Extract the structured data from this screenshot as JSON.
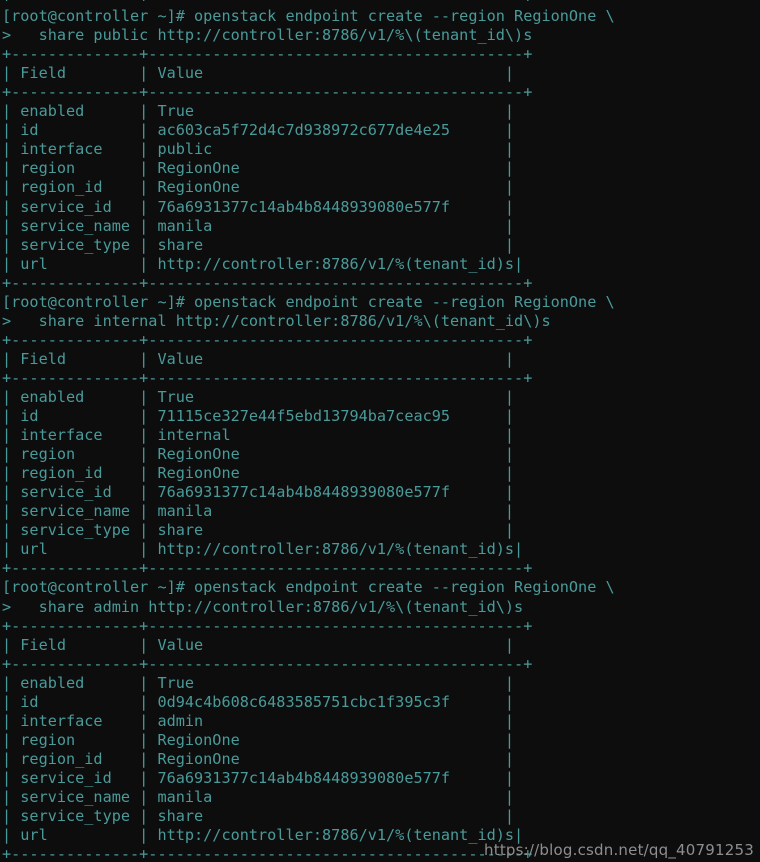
{
  "terminal": {
    "title": "root@controller:~",
    "background_color": "#0d0d0d",
    "foreground_color": "#4a9a9a",
    "prompt": "[root@controller ~]# ",
    "continuation_prompt": "> ",
    "cols": 66,
    "rows": 46
  },
  "table": {
    "headers": [
      "Field",
      "Value"
    ],
    "field_col_width": 14,
    "value_col_width": 39,
    "separator_line": "+--------------+-----------------------------------------+"
  },
  "blocks": [
    {
      "command_line_1": "[root@controller ~]# openstack endpoint create --region RegionOne \\",
      "command_line_2": ">   share public http://controller:8786/v1/%\\(tenant_id\\)s",
      "rows": [
        {
          "field": "enabled",
          "value": "True"
        },
        {
          "field": "id",
          "value": "ac603ca5f72d4c7d938972c677de4e25"
        },
        {
          "field": "interface",
          "value": "public"
        },
        {
          "field": "region",
          "value": "RegionOne"
        },
        {
          "field": "region_id",
          "value": "RegionOne"
        },
        {
          "field": "service_id",
          "value": "76a6931377c14ab4b8448939080e577f"
        },
        {
          "field": "service_name",
          "value": "manila"
        },
        {
          "field": "service_type",
          "value": "share"
        },
        {
          "field": "url",
          "value": "http://controller:8786/v1/%(tenant_id)s"
        }
      ]
    },
    {
      "command_line_1": "[root@controller ~]# openstack endpoint create --region RegionOne \\",
      "command_line_2": ">   share internal http://controller:8786/v1/%\\(tenant_id\\)s",
      "rows": [
        {
          "field": "enabled",
          "value": "True"
        },
        {
          "field": "id",
          "value": "71115ce327e44f5ebd13794ba7ceac95"
        },
        {
          "field": "interface",
          "value": "internal"
        },
        {
          "field": "region",
          "value": "RegionOne"
        },
        {
          "field": "region_id",
          "value": "RegionOne"
        },
        {
          "field": "service_id",
          "value": "76a6931377c14ab4b8448939080e577f"
        },
        {
          "field": "service_name",
          "value": "manila"
        },
        {
          "field": "service_type",
          "value": "share"
        },
        {
          "field": "url",
          "value": "http://controller:8786/v1/%(tenant_id)s"
        }
      ]
    },
    {
      "command_line_1": "[root@controller ~]# openstack endpoint create --region RegionOne \\",
      "command_line_2": ">   share admin http://controller:8786/v1/%\\(tenant_id\\)s",
      "rows": [
        {
          "field": "enabled",
          "value": "True"
        },
        {
          "field": "id",
          "value": "0d94c4b608c6483585751cbc1f395c3f"
        },
        {
          "field": "interface",
          "value": "admin"
        },
        {
          "field": "region",
          "value": "RegionOne"
        },
        {
          "field": "region_id",
          "value": "RegionOne"
        },
        {
          "field": "service_id",
          "value": "76a6931377c14ab4b8448939080e577f"
        },
        {
          "field": "service_name",
          "value": "manila"
        },
        {
          "field": "service_type",
          "value": "share"
        },
        {
          "field": "url",
          "value": "http://controller:8786/v1/%(tenant_id)s"
        }
      ]
    }
  ],
  "watermark": {
    "text": "https://blog.csdn.net/qq_40791253"
  }
}
